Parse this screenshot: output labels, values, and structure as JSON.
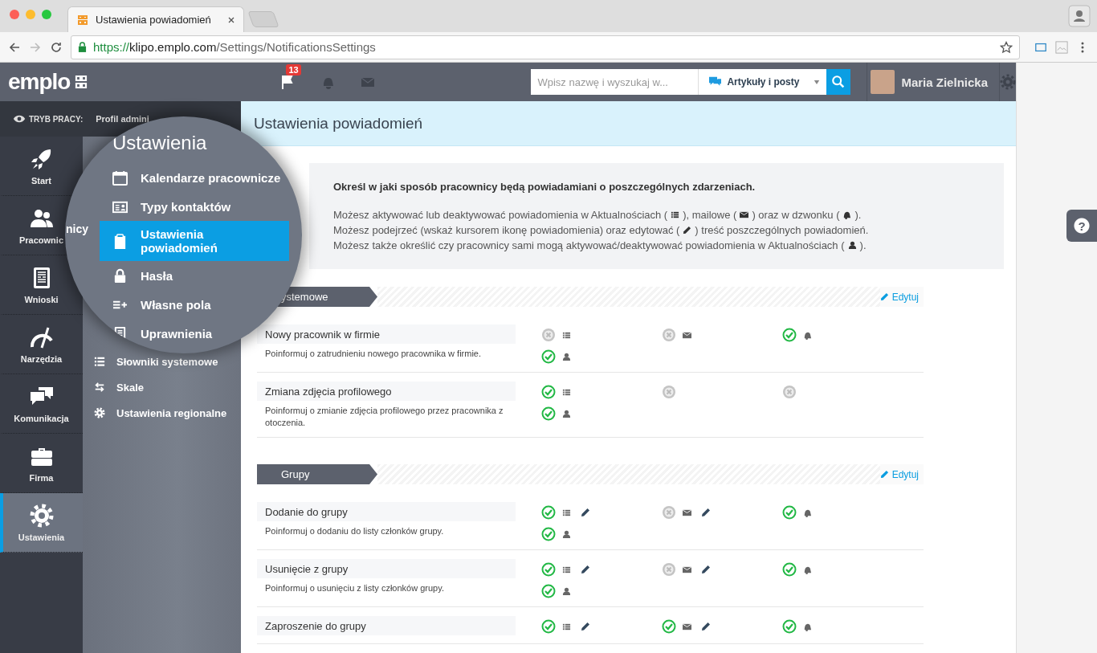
{
  "browser": {
    "tab_title": "Ustawienia powiadomień",
    "url": {
      "scheme": "https://",
      "host": "klipo.emplo.com",
      "path": "/Settings/NotificationsSettings"
    }
  },
  "header": {
    "logo": "emplo",
    "notification_count": "13",
    "search": {
      "placeholder": "Wpisz nazwę i wyszukaj w..."
    },
    "search_scope": "Artykuły i posty",
    "user": "Maria Zielnicka"
  },
  "work_mode": {
    "label": "TRYB PRACY:",
    "value": "Profil admini"
  },
  "nav": [
    {
      "label": "Start",
      "selected": false
    },
    {
      "label": "Pracownic",
      "selected": false
    },
    {
      "label": "Wnioski",
      "selected": false
    },
    {
      "label": "Narzędzia",
      "selected": false
    },
    {
      "label": "Komunikacja",
      "selected": false
    },
    {
      "label": "Firma",
      "selected": false
    },
    {
      "label": "Ustawienia",
      "selected": true
    }
  ],
  "submenu": [
    {
      "label": "Słowniki systemowe"
    },
    {
      "label": "Skale"
    },
    {
      "label": "Ustawienia regionalne"
    }
  ],
  "magnifier": {
    "title": "Ustawienia",
    "fragment": "nicy",
    "items": [
      {
        "label": "Kalendarze pracownicze",
        "selected": false
      },
      {
        "label": "Typy kontaktów",
        "selected": false
      },
      {
        "label": "Ustawienia powiadomień",
        "selected": true
      },
      {
        "label": "Hasła",
        "selected": false
      },
      {
        "label": "Własne pola",
        "selected": false
      },
      {
        "label": "Uprawnienia",
        "selected": false
      }
    ]
  },
  "page_title": "Ustawienia powiadomień",
  "intro": {
    "heading": "Określ w jaki sposób pracownicy będą powiadamiani o poszczególnych zdarzeniach.",
    "lines": [
      {
        "segments": [
          "Możesz aktywować lub deaktywować powiadomienia w Aktualnościach (",
          "), mailowe (",
          ") oraz w dzwonku (",
          ")."
        ]
      },
      {
        "segments": [
          "Możesz podejrzeć (wskaż kursorem ikonę powiadomienia) oraz edytować (",
          ") treść poszczególnych powiadomień."
        ]
      },
      {
        "segments": [
          "Możesz także określić czy pracownicy sami mogą aktywować/deaktywować powiadomienia w Aktualnościach (",
          ")."
        ]
      }
    ]
  },
  "sections": [
    {
      "title": "ystemowe",
      "edit": "Edytuj",
      "rows": [
        {
          "title": "Nowy pracownik w firmie",
          "description": "Poinformuj o zatrudnieniu nowego pracownika w firmie.",
          "channels": [
            {
              "kind": "news",
              "enabled": false,
              "available": true,
              "editable": false
            },
            {
              "kind": "mail",
              "enabled": false,
              "available": true,
              "editable": false
            },
            {
              "kind": "bell",
              "enabled": true,
              "available": true,
              "editable": false
            }
          ],
          "self_service": {
            "enabled": true
          }
        },
        {
          "title": "Zmiana zdjęcia profilowego",
          "description": "Poinformuj o zmianie zdjęcia profilowego przez pracownika z otoczenia.",
          "channels": [
            {
              "kind": "news",
              "enabled": true,
              "available": true,
              "editable": false
            },
            {
              "kind": "mail",
              "enabled": false,
              "available": false,
              "editable": false
            },
            {
              "kind": "bell",
              "enabled": false,
              "available": false,
              "editable": false
            }
          ],
          "self_service": {
            "enabled": true
          }
        }
      ]
    },
    {
      "title": "Grupy",
      "edit": "Edytuj",
      "rows": [
        {
          "title": "Dodanie do grupy",
          "description": "Poinformuj o dodaniu do listy członków grupy.",
          "channels": [
            {
              "kind": "news",
              "enabled": true,
              "available": true,
              "editable": true
            },
            {
              "kind": "mail",
              "enabled": false,
              "available": true,
              "editable": true
            },
            {
              "kind": "bell",
              "enabled": true,
              "available": true,
              "editable": false
            }
          ],
          "self_service": {
            "enabled": true
          }
        },
        {
          "title": "Usunięcie z grupy",
          "description": "Poinformuj o usunięciu z listy członków grupy.",
          "channels": [
            {
              "kind": "news",
              "enabled": true,
              "available": true,
              "editable": true
            },
            {
              "kind": "mail",
              "enabled": false,
              "available": true,
              "editable": true
            },
            {
              "kind": "bell",
              "enabled": true,
              "available": true,
              "editable": false
            }
          ],
          "self_service": {
            "enabled": true
          }
        },
        {
          "title": "Zaproszenie do grupy",
          "channels": [
            {
              "kind": "news",
              "enabled": true,
              "available": true,
              "editable": true
            },
            {
              "kind": "mail",
              "enabled": true,
              "available": true,
              "editable": true
            },
            {
              "kind": "bell",
              "enabled": true,
              "available": true,
              "editable": false
            }
          ]
        }
      ]
    }
  ],
  "help_button": "?"
}
